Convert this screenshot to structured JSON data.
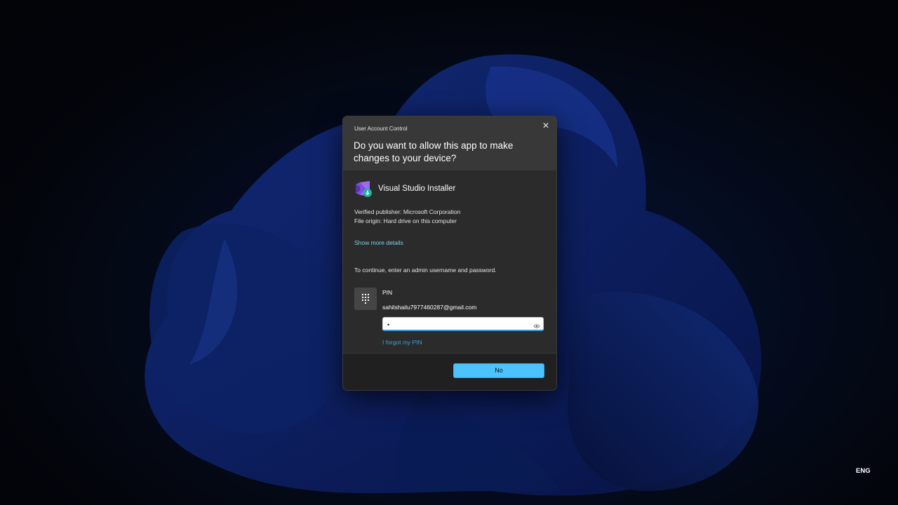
{
  "dialog": {
    "window_title": "User Account Control",
    "close_glyph": "✕",
    "question": "Do you want to allow this app to make changes to your device?",
    "app_name": "Visual Studio Installer",
    "app_icon": "visual-studio-installer-icon",
    "publisher": "Verified publisher: Microsoft Corporation",
    "origin": "File origin: Hard drive on this computer",
    "more_details": "Show more details",
    "continue_text": "To continue, enter an admin username and password.",
    "credential": {
      "method_label": "PIN",
      "method_icon": "keypad-icon",
      "account": "sahilshailu7977460287@gmail.com",
      "pin_value": "•",
      "forgot_link": "I forgot my PIN"
    },
    "no_button": "No"
  },
  "taskbar": {
    "language": "ENG"
  },
  "colors": {
    "accent": "#4cc2ff",
    "link": "#3aa0e0",
    "dialog_bg": "#2b2b2b",
    "header_bg": "#383838",
    "footer_bg": "#202020"
  }
}
